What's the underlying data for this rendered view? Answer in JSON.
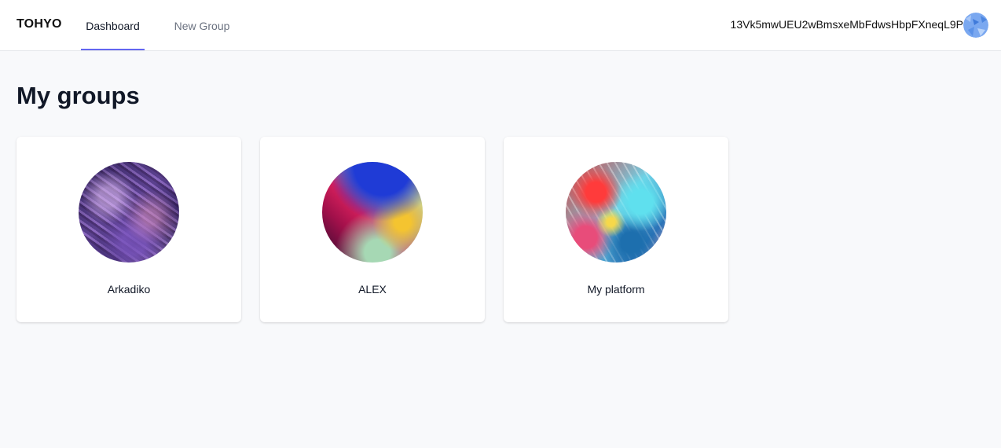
{
  "header": {
    "brand": "TOHYO",
    "tabs": [
      {
        "label": "Dashboard",
        "active": true
      },
      {
        "label": "New Group",
        "active": false
      }
    ],
    "wallet_address": "13Vk5mwUEU2wBmsxeMbFdwsHbpFXneqL9P",
    "avatar_icon": "user-avatar-icon"
  },
  "main": {
    "title": "My groups",
    "groups": [
      {
        "name": "Arkadiko"
      },
      {
        "name": "ALEX"
      },
      {
        "name": "My platform"
      }
    ]
  },
  "colors": {
    "accent": "#6366f1",
    "background": "#f8f9fb",
    "card": "#ffffff"
  }
}
